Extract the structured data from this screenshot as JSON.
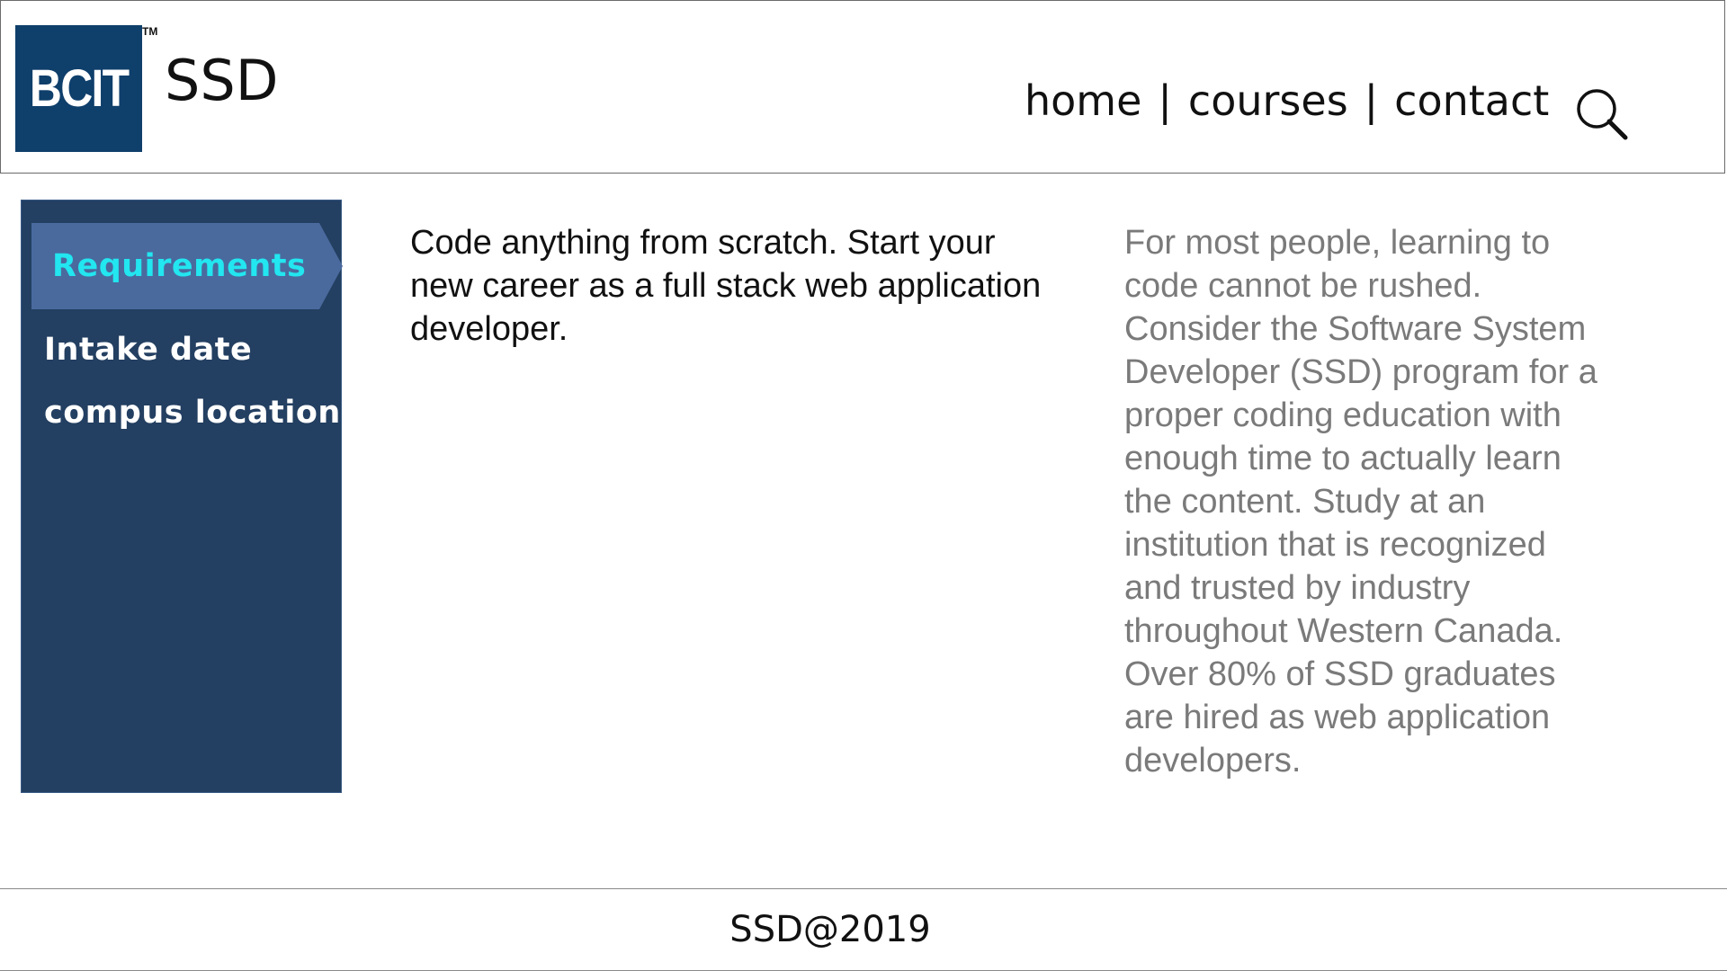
{
  "header": {
    "logo_text": "BCIT",
    "logo_trademark": "TM",
    "site_title": "SSD",
    "nav": {
      "home": "home",
      "separator_1": "|",
      "courses": "courses",
      "separator_2": "|",
      "contact": "contact"
    },
    "search_icon": "search-icon"
  },
  "sidebar": {
    "active_item": "Requirements",
    "items": [
      {
        "label": "Intake date"
      },
      {
        "label": "compus location"
      }
    ]
  },
  "main": {
    "intro": "Code anything from scratch. Start your new career as a full stack web application developer.",
    "description": "For most people, learning to code cannot be rushed. Consider the Software System Developer (SSD) program for a proper coding education with enough time to actually learn the content. Study at an institution that is recognized and trusted by industry throughout Western Canada. Over 80% of SSD graduates are hired as web application developers."
  },
  "footer": {
    "text": "SSD@2019"
  },
  "colors": {
    "logo_bg": "#0f3f6b",
    "sidebar_bg": "#233f61",
    "sidebar_active_bg": "#4a6a9e",
    "sidebar_active_text": "#22e6f0",
    "description_text": "#7a7a7a"
  }
}
